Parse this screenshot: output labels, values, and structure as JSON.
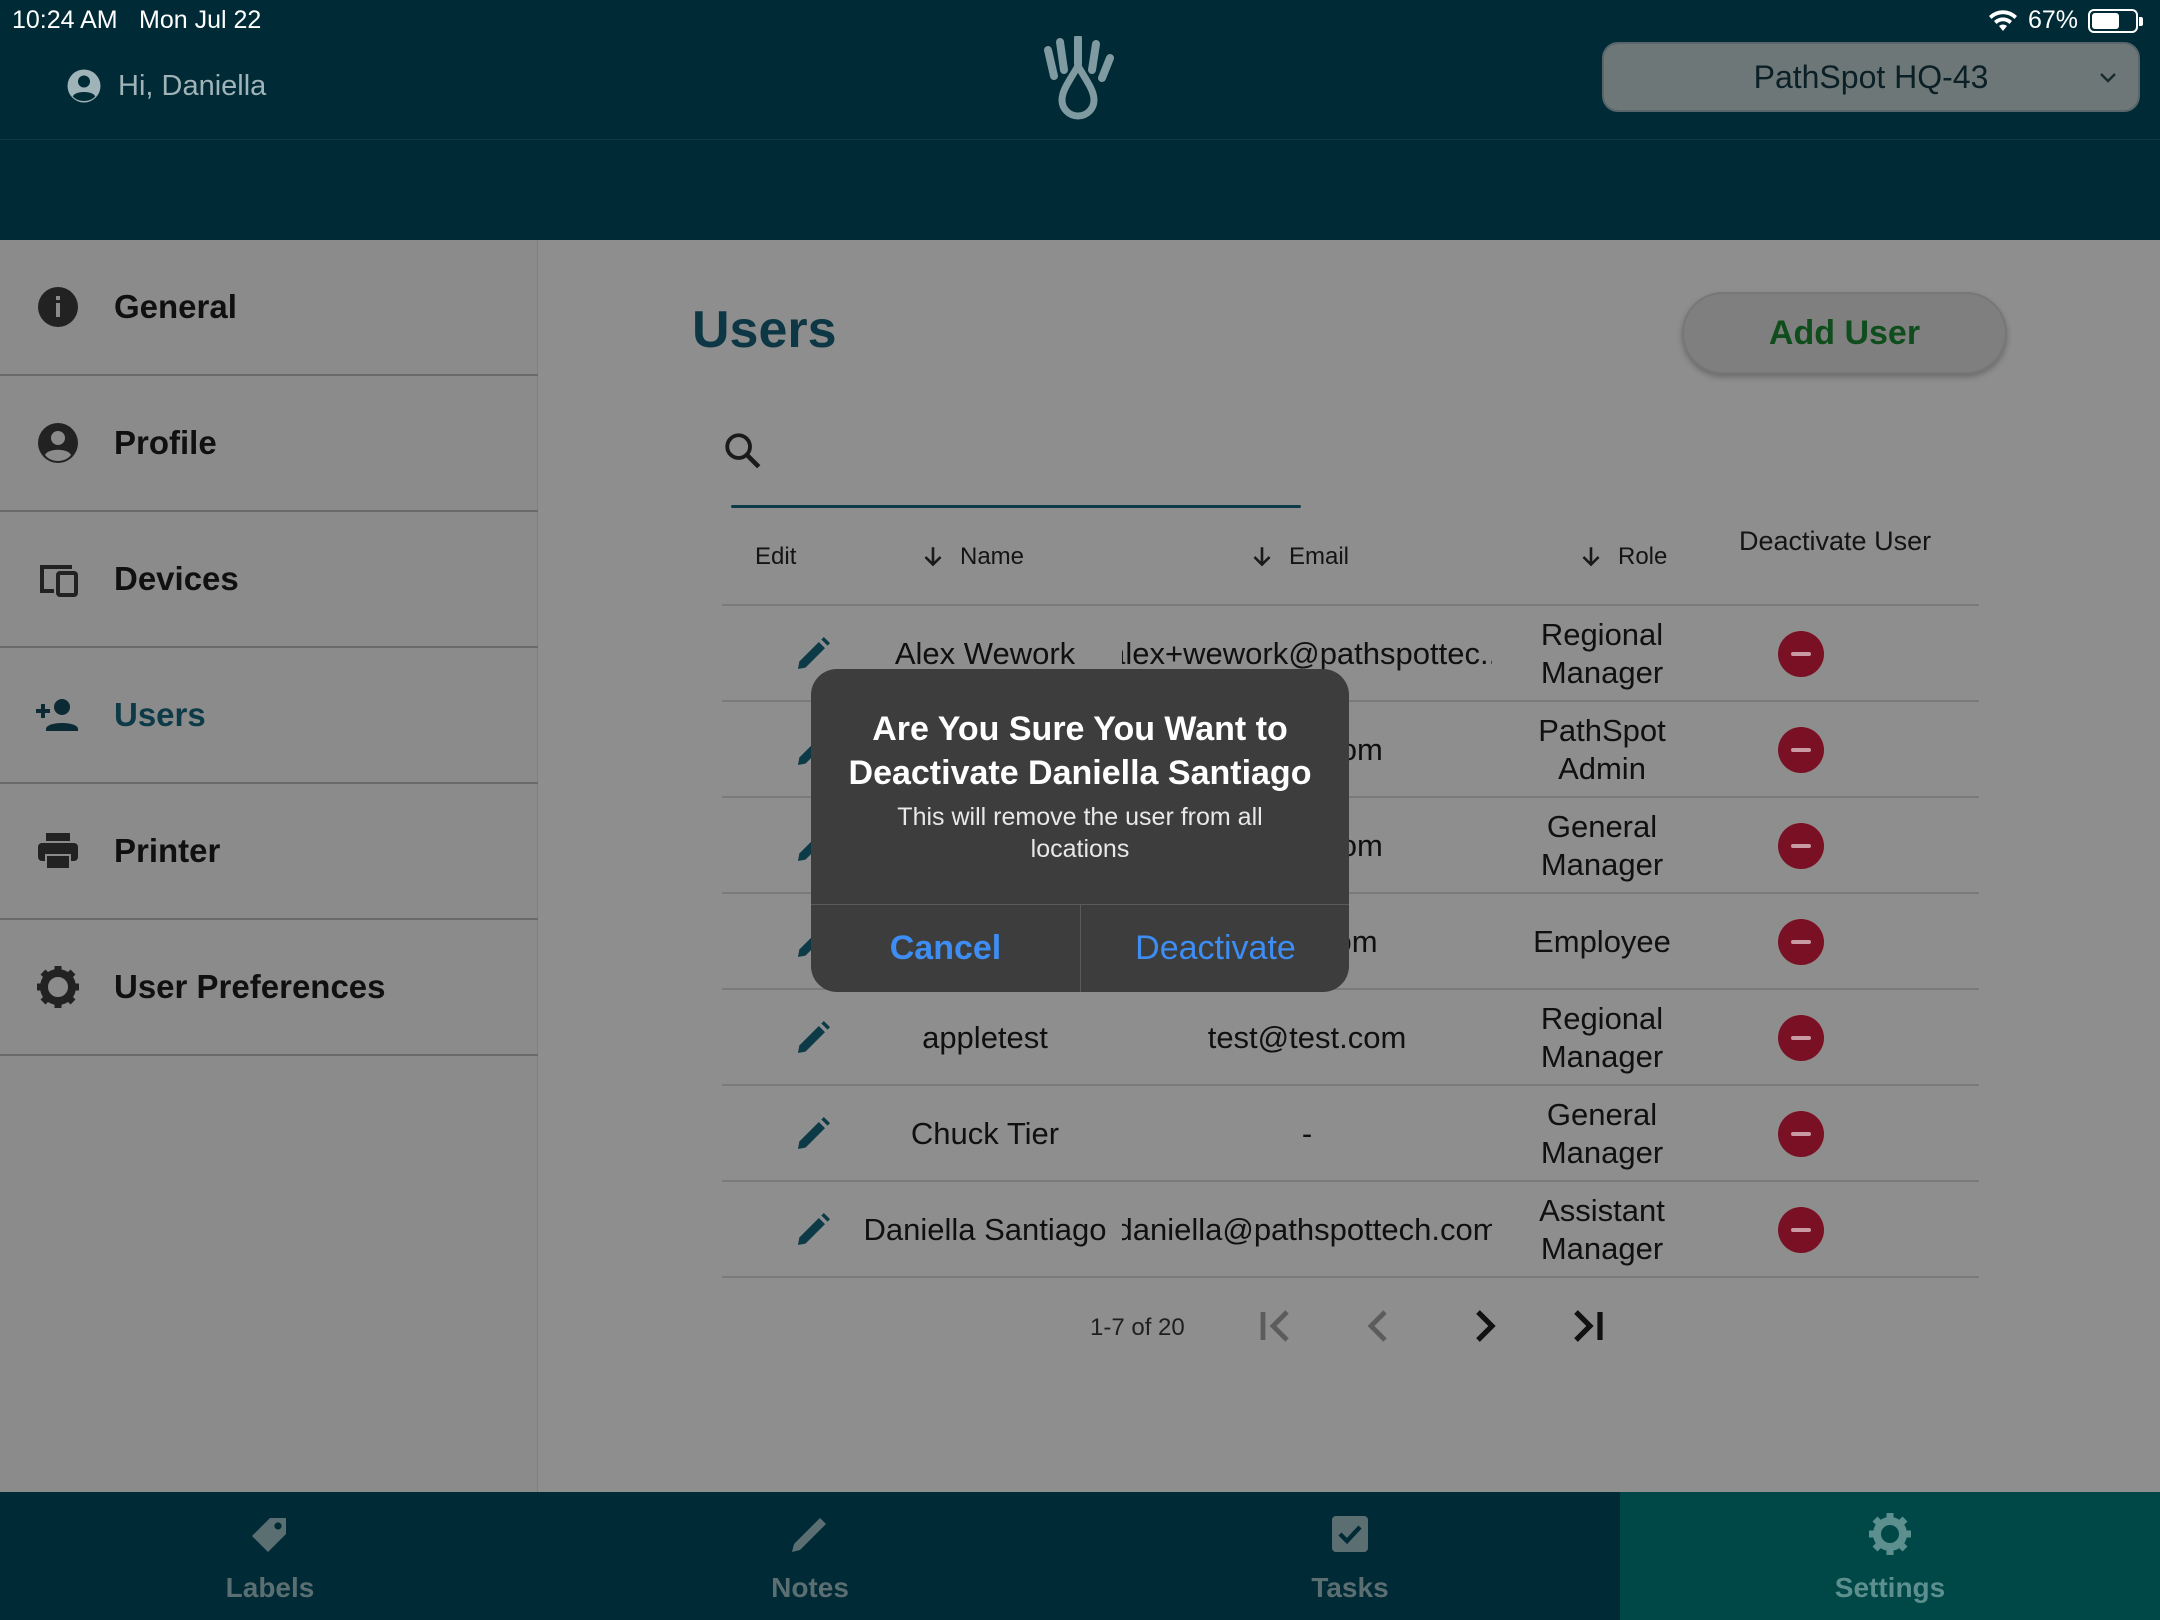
{
  "status_bar": {
    "time": "10:24 AM",
    "date": "Mon Jul 22",
    "battery": "67%",
    "battery_level": 0.67
  },
  "header": {
    "greeting": "Hi, Daniella",
    "location": "PathSpot HQ-43"
  },
  "sidebar": {
    "items": [
      {
        "label": "General",
        "icon": "info-icon"
      },
      {
        "label": "Profile",
        "icon": "account-circle-icon"
      },
      {
        "label": "Devices",
        "icon": "devices-icon"
      },
      {
        "label": "Users",
        "icon": "add-person-icon",
        "active": true
      },
      {
        "label": "Printer",
        "icon": "printer-icon"
      },
      {
        "label": "User Preferences",
        "icon": "gear-icon"
      }
    ]
  },
  "main": {
    "title": "Users",
    "add_user_label": "Add User",
    "search_placeholder": "",
    "columns": {
      "edit": "Edit",
      "name": "Name",
      "email": "Email",
      "role": "Role",
      "deactivate": "Deactivate User"
    },
    "rows": [
      {
        "name": "Alex Wework",
        "email": "alex+wework@pathspottec...",
        "role": "Regional Manager"
      },
      {
        "name": "",
        "email": "ottech.com",
        "role": "PathSpot Admin"
      },
      {
        "name": "",
        "email": "ottech.com",
        "role": "General Manager"
      },
      {
        "name": "",
        "email": "gmail.com",
        "role": "Employee"
      },
      {
        "name": "appletest",
        "email": "test@test.com",
        "role": "Regional Manager"
      },
      {
        "name": "Chuck Tier",
        "email": "-",
        "role": "General Manager"
      },
      {
        "name": "Daniella Santiago",
        "email": "daniella@pathspottech.com",
        "role": "Assistant Manager"
      }
    ],
    "pagination": "1-7 of 20"
  },
  "dialog": {
    "title": "Are You Sure You Want to Deactivate Daniella Santiago",
    "message": "This will remove the user from all locations",
    "cancel": "Cancel",
    "confirm": "Deactivate"
  },
  "tabbar": {
    "tabs": [
      {
        "label": "Labels",
        "icon": "tag-icon"
      },
      {
        "label": "Notes",
        "icon": "pencil-icon"
      },
      {
        "label": "Tasks",
        "icon": "checkbox-icon"
      },
      {
        "label": "Settings",
        "icon": "gear-icon",
        "active": true
      }
    ]
  },
  "colors": {
    "header_bg": "#002a35",
    "accent": "#0c3a46",
    "danger": "#7a1024",
    "alert_button": "#3d8df3"
  }
}
